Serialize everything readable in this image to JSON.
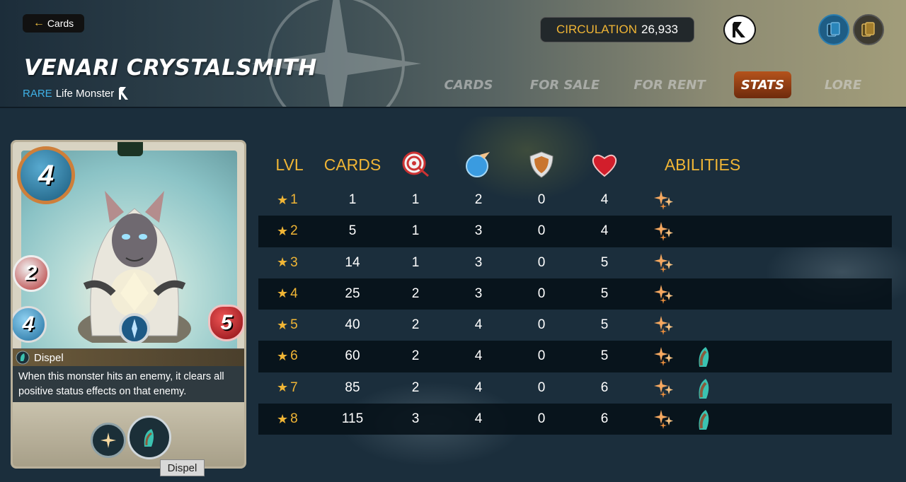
{
  "header": {
    "back_label": "Cards",
    "title": "VENARI CRYSTALSMITH",
    "rarity": "RARE",
    "type": "Life Monster",
    "circulation_label": "CIRCULATION",
    "circulation_value": "26,933"
  },
  "tabs": [
    {
      "label": "CARDS",
      "active": false
    },
    {
      "label": "FOR SALE",
      "active": false
    },
    {
      "label": "FOR RENT",
      "active": false
    },
    {
      "label": "STATS",
      "active": true
    },
    {
      "label": "LORE",
      "active": false
    }
  ],
  "card": {
    "mana": "4",
    "melee": "2",
    "speed": "4",
    "health": "5",
    "ability_name": "Dispel",
    "ability_description": "When this monster hits an enemy, it clears all positive status effects on that enemy.",
    "tooltip": "Dispel"
  },
  "table": {
    "headers": {
      "lvl": "LVL",
      "cards": "CARDS",
      "melee_icon": "target-icon",
      "speed_icon": "speed-orb-icon",
      "armor_icon": "shield-icon",
      "health_icon": "heart-icon",
      "abilities": "ABILITIES"
    },
    "rows": [
      {
        "lvl": "1",
        "cards": "1",
        "melee": "1",
        "speed": "2",
        "armor": "0",
        "health": "4",
        "abilities": [
          "sparkle-ability-icon"
        ]
      },
      {
        "lvl": "2",
        "cards": "5",
        "melee": "1",
        "speed": "3",
        "armor": "0",
        "health": "4",
        "abilities": [
          "sparkle-ability-icon"
        ]
      },
      {
        "lvl": "3",
        "cards": "14",
        "melee": "1",
        "speed": "3",
        "armor": "0",
        "health": "5",
        "abilities": [
          "sparkle-ability-icon"
        ]
      },
      {
        "lvl": "4",
        "cards": "25",
        "melee": "2",
        "speed": "3",
        "armor": "0",
        "health": "5",
        "abilities": [
          "sparkle-ability-icon"
        ]
      },
      {
        "lvl": "5",
        "cards": "40",
        "melee": "2",
        "speed": "4",
        "armor": "0",
        "health": "5",
        "abilities": [
          "sparkle-ability-icon"
        ]
      },
      {
        "lvl": "6",
        "cards": "60",
        "melee": "2",
        "speed": "4",
        "armor": "0",
        "health": "5",
        "abilities": [
          "sparkle-ability-icon",
          "dispel-ability-icon"
        ]
      },
      {
        "lvl": "7",
        "cards": "85",
        "melee": "2",
        "speed": "4",
        "armor": "0",
        "health": "6",
        "abilities": [
          "sparkle-ability-icon",
          "dispel-ability-icon"
        ]
      },
      {
        "lvl": "8",
        "cards": "115",
        "melee": "3",
        "speed": "4",
        "armor": "0",
        "health": "6",
        "abilities": [
          "sparkle-ability-icon",
          "dispel-ability-icon"
        ]
      }
    ]
  },
  "colors": {
    "accent_gold": "#f0b535",
    "rarity_blue": "#3fb1e6",
    "active_tab": "#b5531c"
  }
}
